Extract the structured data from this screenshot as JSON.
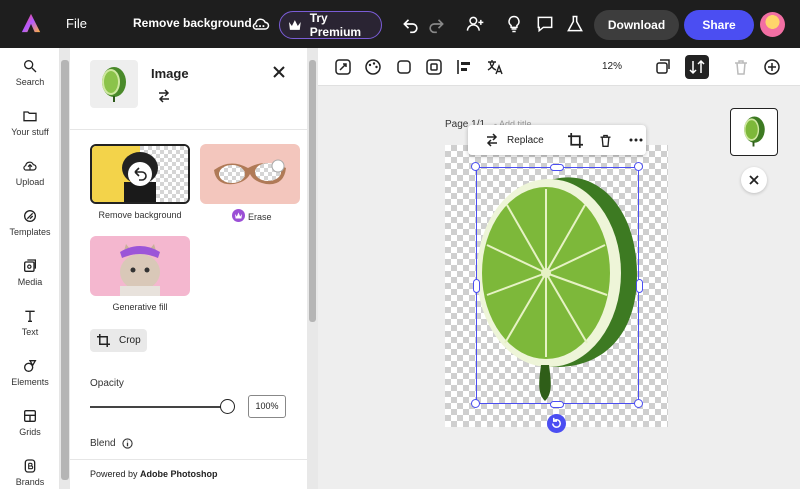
{
  "topbar": {
    "file_label": "File",
    "doc_title": "Remove background ...",
    "premium_label": "Try Premium",
    "download_label": "Download",
    "share_label": "Share"
  },
  "rail": {
    "items": [
      {
        "label": "Search",
        "icon": "search-icon"
      },
      {
        "label": "Your stuff",
        "icon": "folder-icon"
      },
      {
        "label": "Upload",
        "icon": "upload-icon"
      },
      {
        "label": "Templates",
        "icon": "templates-icon"
      },
      {
        "label": "Media",
        "icon": "media-icon"
      },
      {
        "label": "Text",
        "icon": "text-icon"
      },
      {
        "label": "Elements",
        "icon": "elements-icon"
      },
      {
        "label": "Grids",
        "icon": "grids-icon"
      },
      {
        "label": "Brands",
        "icon": "brands-icon"
      }
    ]
  },
  "panel": {
    "title": "Image",
    "actions": [
      {
        "label": "Remove background"
      },
      {
        "label": "Erase"
      },
      {
        "label": "Generative fill"
      }
    ],
    "crop_label": "Crop",
    "opacity_label": "Opacity",
    "opacity_value": "100%",
    "opacity_level": 1.0,
    "blend_label": "Blend",
    "footer_prefix": "Powered by ",
    "footer_brand": "Adobe Photoshop"
  },
  "canvas": {
    "zoom": "12%",
    "page_label": "Page 1/1",
    "page_sub": "- Add title",
    "replace_label": "Replace"
  },
  "colors": {
    "accent": "#4b4ef2",
    "premium_border": "#7a5cd6",
    "topbar_bg": "#1e1e1e"
  }
}
